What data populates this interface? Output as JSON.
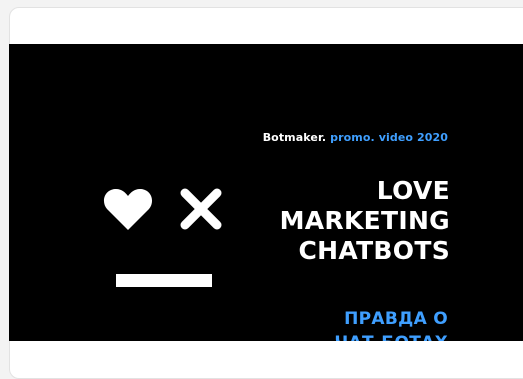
{
  "promo": {
    "brand": "Botmaker.",
    "rest": " promo. video 2020"
  },
  "headline": {
    "line1": "LOVE",
    "line2": "MARKETING",
    "line3": "CHATBOTS"
  },
  "subhead": {
    "line1": "ПРАВДА О",
    "line2": "ЧАТ-БОТАХ"
  },
  "icons": {
    "left_eye": "heart-icon",
    "right_eye": "x-icon",
    "mouth": "bar-shape"
  },
  "colors": {
    "background": "#000000",
    "text_primary": "#ffffff",
    "accent": "#3f9fff"
  }
}
